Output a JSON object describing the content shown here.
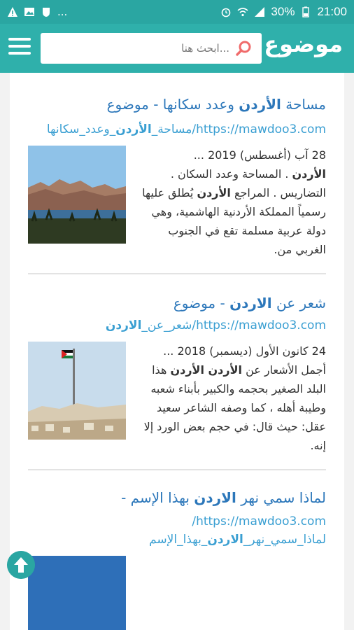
{
  "status": {
    "battery": "30%",
    "time": "21:00",
    "more": "..."
  },
  "header": {
    "logo": "موضوع",
    "search_placeholder": "ابحث هنا..."
  },
  "results": [
    {
      "title_pre": "مساحة ",
      "title_bold": "الأردن",
      "title_post": " وعدد سكانها - موضوع",
      "url_pre": "https://mawdoo3.com/مساحة_",
      "url_bold": "الأردن",
      "url_post": "_وعدد_سكانها",
      "snippet_date": "28 آب (أغسطس) 2019 ...",
      "snippet_b1": "الأردن",
      "snippet_t1": " . المساحة وعدد السكان . التضاريس . المراجع ",
      "snippet_b2": "الأردن",
      "snippet_t2": " يُطلق عليها رسمياً المملكة الأردنية الهاشمية، وهي دولة عربية مسلمة تقع في الجنوب الغربي من."
    },
    {
      "title_pre": "شعر عن ",
      "title_bold": "الاردن",
      "title_post": " - موضوع",
      "url_pre": "https://mawdoo3.com/شعر_عن_",
      "url_bold": "الاردن",
      "url_post": "",
      "snippet_date": "24 كانون الأول (ديسمبر) 2018 ... أجمل الأشعار عن",
      "snippet_b1": "الأردن الأردن",
      "snippet_t1": " هذا البلد الصغير بحجمه والكبير بأبناء شعبه وطيبة أهله ، كما وصفه الشاعر سعيد عقل: حيث قال: في حجم بعض الورد إلا إنه.",
      "snippet_b2": "",
      "snippet_t2": ""
    },
    {
      "title_pre": "لماذا سمي نهر ",
      "title_bold": "الاردن",
      "title_post": " بهذا الإسم -",
      "url_pre": "https://mawdoo3.com/لماذا_سمي_نهر_",
      "url_bold": "الاردن",
      "url_post": "_بهذا_الإسم"
    }
  ],
  "colors": {
    "accent": "#2fb0ab",
    "title": "#2c77ba",
    "url": "#3a9fd2"
  }
}
